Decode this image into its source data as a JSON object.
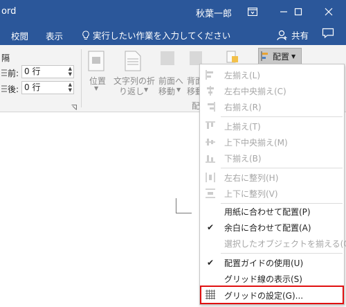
{
  "window": {
    "app_title": "ord",
    "user_name": "秋葉一郎",
    "buttons": [
      "ribbon-display-options",
      "minimize",
      "maximize",
      "close"
    ]
  },
  "tabs": {
    "review": "校閲",
    "view": "表示",
    "tell_me": "実行したい作業を入力してください",
    "share": "共有"
  },
  "ribbon": {
    "spacing_heading": "隔",
    "before_label": "前:",
    "before_value": "0 行",
    "after_label": "後:",
    "after_value": "0 行",
    "position_label": "位置",
    "wrap_label_1": "文字列の折",
    "wrap_label_2": "り返し",
    "bring_forward_1": "前面へ",
    "bring_forward_2": "移動",
    "send_backward_1": "背面",
    "send_backward_2": "移動",
    "arrange_group_fragment": "配",
    "arrange_button": "配置"
  },
  "menu": {
    "items": [
      {
        "label": "左揃え(L)",
        "enabled": false,
        "icon": "align-left-icon"
      },
      {
        "label": "左右中央揃え(C)",
        "enabled": false,
        "icon": "align-center-icon"
      },
      {
        "label": "右揃え(R)",
        "enabled": false,
        "icon": "align-right-icon"
      },
      {
        "label": "上揃え(T)",
        "enabled": false,
        "icon": "align-top-icon"
      },
      {
        "label": "上下中央揃え(M)",
        "enabled": false,
        "icon": "align-middle-icon"
      },
      {
        "label": "下揃え(B)",
        "enabled": false,
        "icon": "align-bottom-icon"
      },
      {
        "label": "左右に整列(H)",
        "enabled": false,
        "icon": "distribute-horizontal-icon"
      },
      {
        "label": "上下に整列(V)",
        "enabled": false,
        "icon": "distribute-vertical-icon"
      },
      {
        "label": "用紙に合わせて配置(P)",
        "enabled": true,
        "icon": ""
      },
      {
        "label": "余白に合わせて配置(A)",
        "enabled": true,
        "icon": "check-icon",
        "checked": true
      },
      {
        "label": "選択したオブジェクトを揃える(O)",
        "enabled": false,
        "icon": ""
      },
      {
        "label": "配置ガイドの使用(U)",
        "enabled": true,
        "icon": "check-icon",
        "checked": true
      },
      {
        "label": "グリッド線の表示(S)",
        "enabled": true,
        "icon": ""
      },
      {
        "label": "グリッドの設定(G)...",
        "enabled": true,
        "icon": "grid-icon",
        "highlighted": true
      }
    ]
  },
  "colors": {
    "title_bar": "#2b579a",
    "ribbon_bg": "#f3f3f3",
    "highlight_border": "#e01010",
    "disabled_text": "#a6a6a6"
  }
}
